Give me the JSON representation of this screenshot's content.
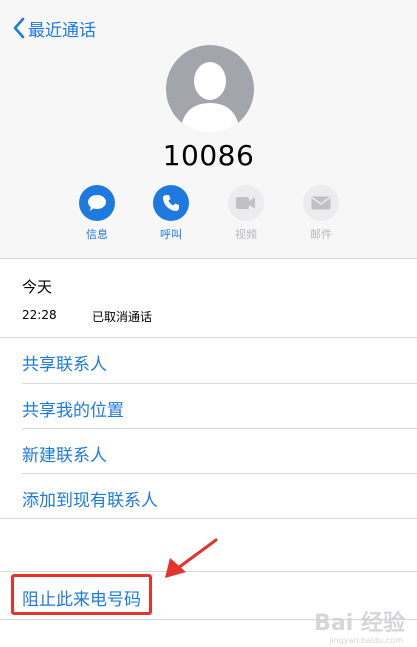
{
  "nav": {
    "back_label": "最近通话"
  },
  "contact": {
    "number": "10086"
  },
  "actions": [
    {
      "label": "信息",
      "icon": "message-icon",
      "state": "active"
    },
    {
      "label": "呼叫",
      "icon": "phone-icon",
      "state": "active"
    },
    {
      "label": "视频",
      "icon": "video-icon",
      "state": "disabled"
    },
    {
      "label": "邮件",
      "icon": "mail-icon",
      "state": "disabled"
    }
  ],
  "recent": {
    "day": "今天",
    "time": "22:28",
    "status": "已取消通话"
  },
  "menu": [
    {
      "label": "共享联系人"
    },
    {
      "label": "共享我的位置"
    },
    {
      "label": "新建联系人"
    },
    {
      "label": "添加到现有联系人"
    }
  ],
  "block": {
    "label": "阻止此来电号码"
  },
  "watermark": {
    "text": "Bai 经验",
    "url": "jingyan.baidu.com"
  },
  "colors": {
    "accent": "#1f7ae0",
    "highlight": "#e5322d",
    "avatar": "#a2a5ab"
  }
}
